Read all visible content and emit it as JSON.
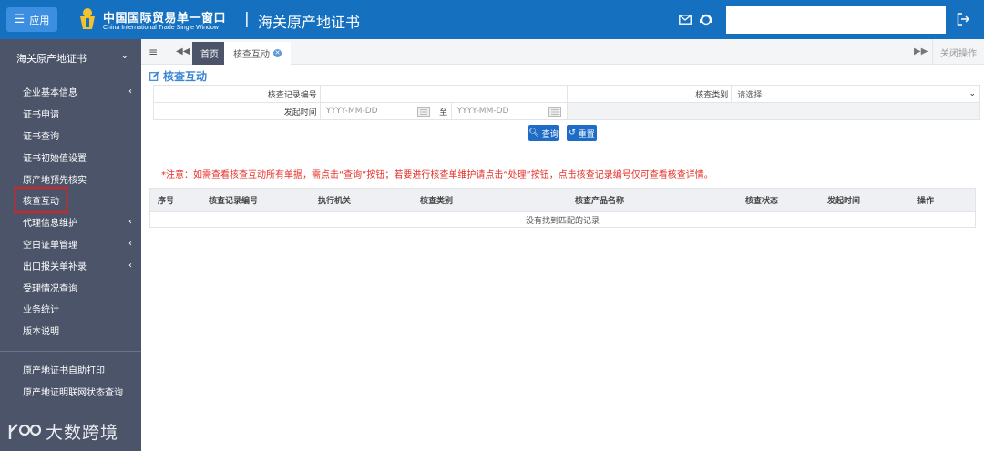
{
  "header": {
    "app_button": "应用",
    "brand_cn": "中国国际贸易单一窗口",
    "brand_en": "China International Trade Single Window",
    "separator": "|",
    "system_title": "海关原产地证书",
    "search_value": ""
  },
  "sidebar": {
    "section_title": "海关原产地证书",
    "items": [
      {
        "label": "企业基本信息",
        "arrow": "‹"
      },
      {
        "label": "证书申请",
        "arrow": ""
      },
      {
        "label": "证书查询",
        "arrow": ""
      },
      {
        "label": "证书初始值设置",
        "arrow": ""
      },
      {
        "label": "原产地预先核实",
        "arrow": ""
      },
      {
        "label": "核查互动",
        "arrow": ""
      },
      {
        "label": "代理信息维护",
        "arrow": "‹"
      },
      {
        "label": "空白证单管理",
        "arrow": "‹"
      },
      {
        "label": "出口报关单补录",
        "arrow": "‹"
      },
      {
        "label": "受理情况查询",
        "arrow": ""
      },
      {
        "label": "业务统计",
        "arrow": ""
      },
      {
        "label": "版本说明",
        "arrow": ""
      }
    ],
    "extra_items": [
      {
        "label": "原产地证书自助打印"
      },
      {
        "label": "原产地证明联网状态查询"
      }
    ],
    "watermark": "大数跨境"
  },
  "tabs": {
    "home": "首页",
    "active": "核查互动",
    "close_ops": "关闭操作"
  },
  "page": {
    "title": "核查互动",
    "form": {
      "record_no_label": "核查记录编号",
      "record_no_value": "",
      "category_label": "核查类别",
      "category_value": "请选择",
      "start_time_label": "发起时间",
      "date_from_placeholder": "YYYY-MM-DD",
      "date_to_label": "至",
      "date_to_placeholder": "YYYY-MM-DD"
    },
    "buttons": {
      "query": "查询",
      "reset": "重置"
    },
    "notice": "*注意：如需查看核查互动所有单据，需点击“查询”按钮；若要进行核查单维护请点击“处理”按钮，点击核查记录编号仅可查看核查详情。",
    "table": {
      "columns": [
        "序号",
        "核查记录编号",
        "执行机关",
        "核查类别",
        "核查产品名称",
        "核查状态",
        "发起时间",
        "操作"
      ],
      "empty_text": "没有找到匹配的记录"
    }
  },
  "colors": {
    "topbar": "#1570c0",
    "sidebar": "#4b5468",
    "accent": "#1f6cc6",
    "notice": "#e5312a",
    "highlight_border": "#e02020"
  }
}
